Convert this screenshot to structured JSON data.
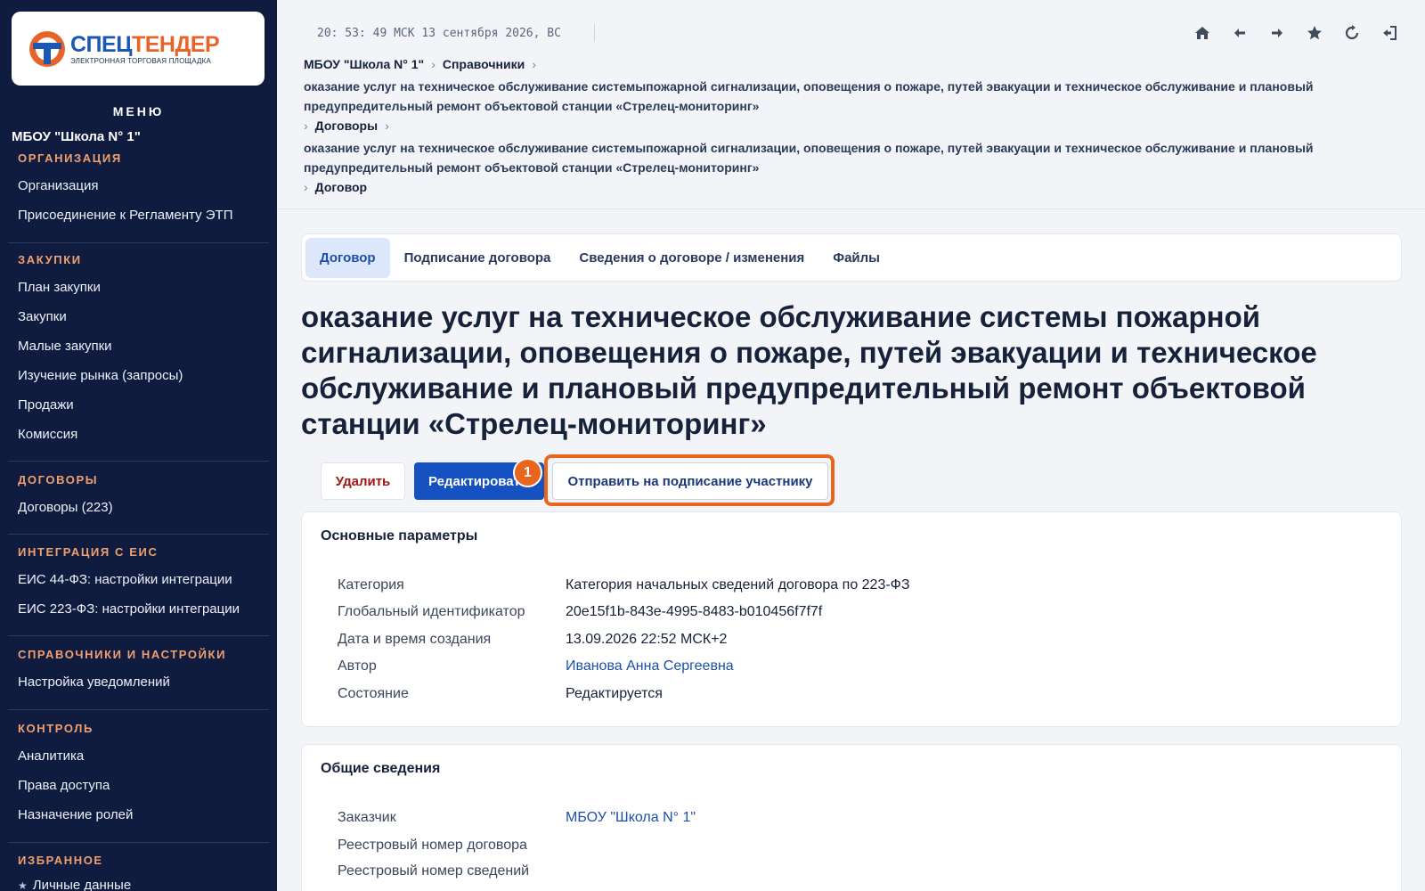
{
  "logo": {
    "name_a": "СПЕЦ",
    "name_b": "ТЕНДЕР",
    "subtitle": "ЭЛЕКТРОННАЯ ТОРГОВАЯ ПЛОЩАДКА"
  },
  "sidebar": {
    "menu_title": "МЕНЮ",
    "org_name": "МБОУ \"Школа N° 1\"",
    "sections": [
      {
        "title": "ОРГАНИЗАЦИЯ",
        "items": [
          "Организация",
          "Присоединение к Регламенту ЭТП"
        ]
      },
      {
        "title": "ЗАКУПКИ",
        "items": [
          "План закупки",
          "Закупки",
          "Малые закупки",
          "Изучение рынка (запросы)",
          "Продажи",
          "Комиссия"
        ]
      },
      {
        "title": "ДОГОВОРЫ",
        "items": [
          "Договоры (223)"
        ]
      },
      {
        "title": "ИНТЕГРАЦИЯ С ЕИС",
        "items": [
          "ЕИС 44-ФЗ: настройки интеграции",
          "ЕИС 223-ФЗ: настройки интеграции"
        ]
      },
      {
        "title": "СПРАВОЧНИКИ И НАСТРОЙКИ",
        "items": [
          "Настройка уведомлений"
        ]
      },
      {
        "title": "КОНТРОЛЬ",
        "items": [
          "Аналитика",
          "Права доступа",
          "Назначение ролей"
        ]
      },
      {
        "title": "ИЗБРАННОЕ",
        "items": [
          "Личные данные"
        ]
      }
    ]
  },
  "topbar": {
    "clock": "20: 53: 49 МСК  13 сентября 2026, ВС",
    "icons": [
      "home-icon",
      "back-arrow-icon",
      "forward-arrow-icon",
      "star-icon",
      "refresh-icon",
      "logout-icon"
    ]
  },
  "breadcrumbs": {
    "org": "МБОУ \"Школа N° 1\"",
    "refs": "Справочники",
    "long1": "оказание услуг на техническое обслуживание системыпожарной сигнализации, оповещения о пожаре, путей эвакуации и техническое обслуживание и плановый предупредительный ремонт объектовой станции «Стрелец-мониторинг»",
    "contracts": "Договоры",
    "long2": "оказание услуг на техническое обслуживание системыпожарной сигнализации, оповещения о пожаре, путей эвакуации и техническое обслуживание и плановый предупредительный ремонт объектовой станции «Стрелец-мониторинг»",
    "current": "Договор"
  },
  "tabs": [
    "Договор",
    "Подписание договора",
    "Сведения о договоре / изменения",
    "Файлы"
  ],
  "page_title": "оказание услуг на техническое обслуживание системы пожарной сигнализации, оповещения о пожаре, путей эвакуации и техническое обслуживание и плановый предупредительный ремонт объектовой станции «Стрелец-мониторинг»",
  "actions": {
    "delete": "Удалить",
    "edit": "Редактировать",
    "send": "Отправить на подписание участнику",
    "badge": "1"
  },
  "main_params": {
    "title": "Основные параметры",
    "rows": [
      {
        "label": "Категория",
        "value": "Категория начальных сведений договора по 223-ФЗ"
      },
      {
        "label": "Глобальный идентификатор",
        "value": "20e15f1b-843e-4995-8483-b010456f7f7f"
      },
      {
        "label": "Дата и время создания",
        "value": "13.09.2026 22:52 МСК+2"
      },
      {
        "label": "Автор",
        "value": "Иванова Анна Сергеевна"
      },
      {
        "label": "Состояние",
        "value": "Редактируется"
      }
    ]
  },
  "general": {
    "title": "Общие сведения",
    "rows": [
      {
        "label": "Заказчик",
        "value": "МБОУ \"Школа N° 1\""
      },
      {
        "label": "Реестровый номер договора",
        "value": ""
      },
      {
        "label": "Реестровый номер сведений",
        "value": ""
      }
    ]
  },
  "colors": {
    "sidebar_bg": "#0f1c3f",
    "accent": "#1651c2",
    "highlight": "#e8651e",
    "section_title": "#f0a070"
  }
}
